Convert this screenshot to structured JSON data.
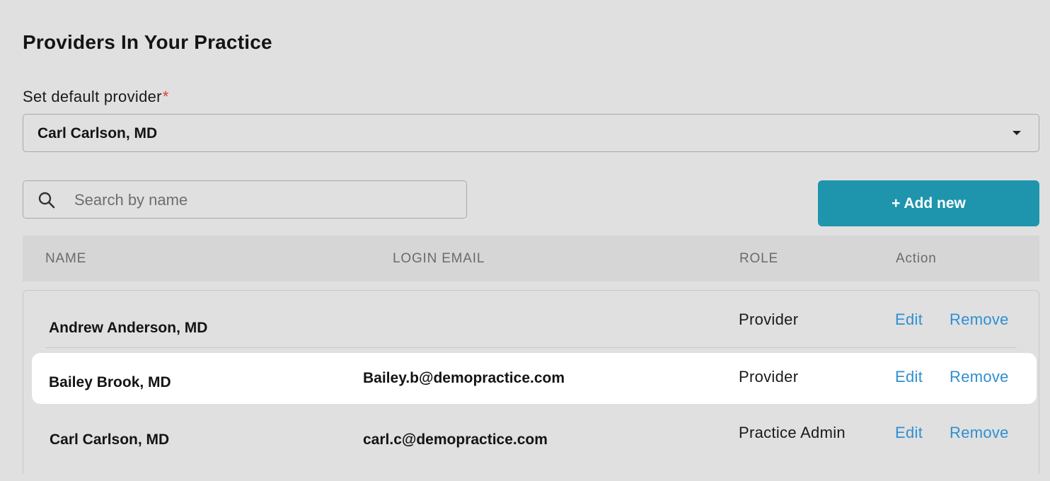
{
  "section": {
    "title": "Providers In Your Practice"
  },
  "default_provider": {
    "label": "Set default provider",
    "required_mark": "*",
    "selected": "Carl Carlson, MD"
  },
  "search": {
    "placeholder": "Search by name",
    "value": ""
  },
  "add_button": {
    "label": "+ Add new"
  },
  "table": {
    "columns": {
      "name": "NAME",
      "email": "LOGIN EMAIL",
      "role": "ROLE",
      "action": "Action"
    },
    "rows": [
      {
        "name": "Andrew Anderson, MD",
        "email": "",
        "role": "Provider",
        "edit": "Edit",
        "remove": "Remove"
      },
      {
        "name": "Bailey Brook, MD",
        "email": "Bailey.b@demopractice.com",
        "role": "Provider",
        "edit": "Edit",
        "remove": "Remove"
      },
      {
        "name": "Carl Carlson, MD",
        "email": "carl.c@demopractice.com",
        "role": "Practice Admin",
        "edit": "Edit",
        "remove": "Remove"
      }
    ]
  },
  "colors": {
    "accent": "#1e95ac",
    "link": "#2f8fd2",
    "required": "#e53935",
    "background": "#e0e0e0"
  },
  "icons": {
    "search": "search-icon",
    "dropdown": "caret-down-icon"
  }
}
